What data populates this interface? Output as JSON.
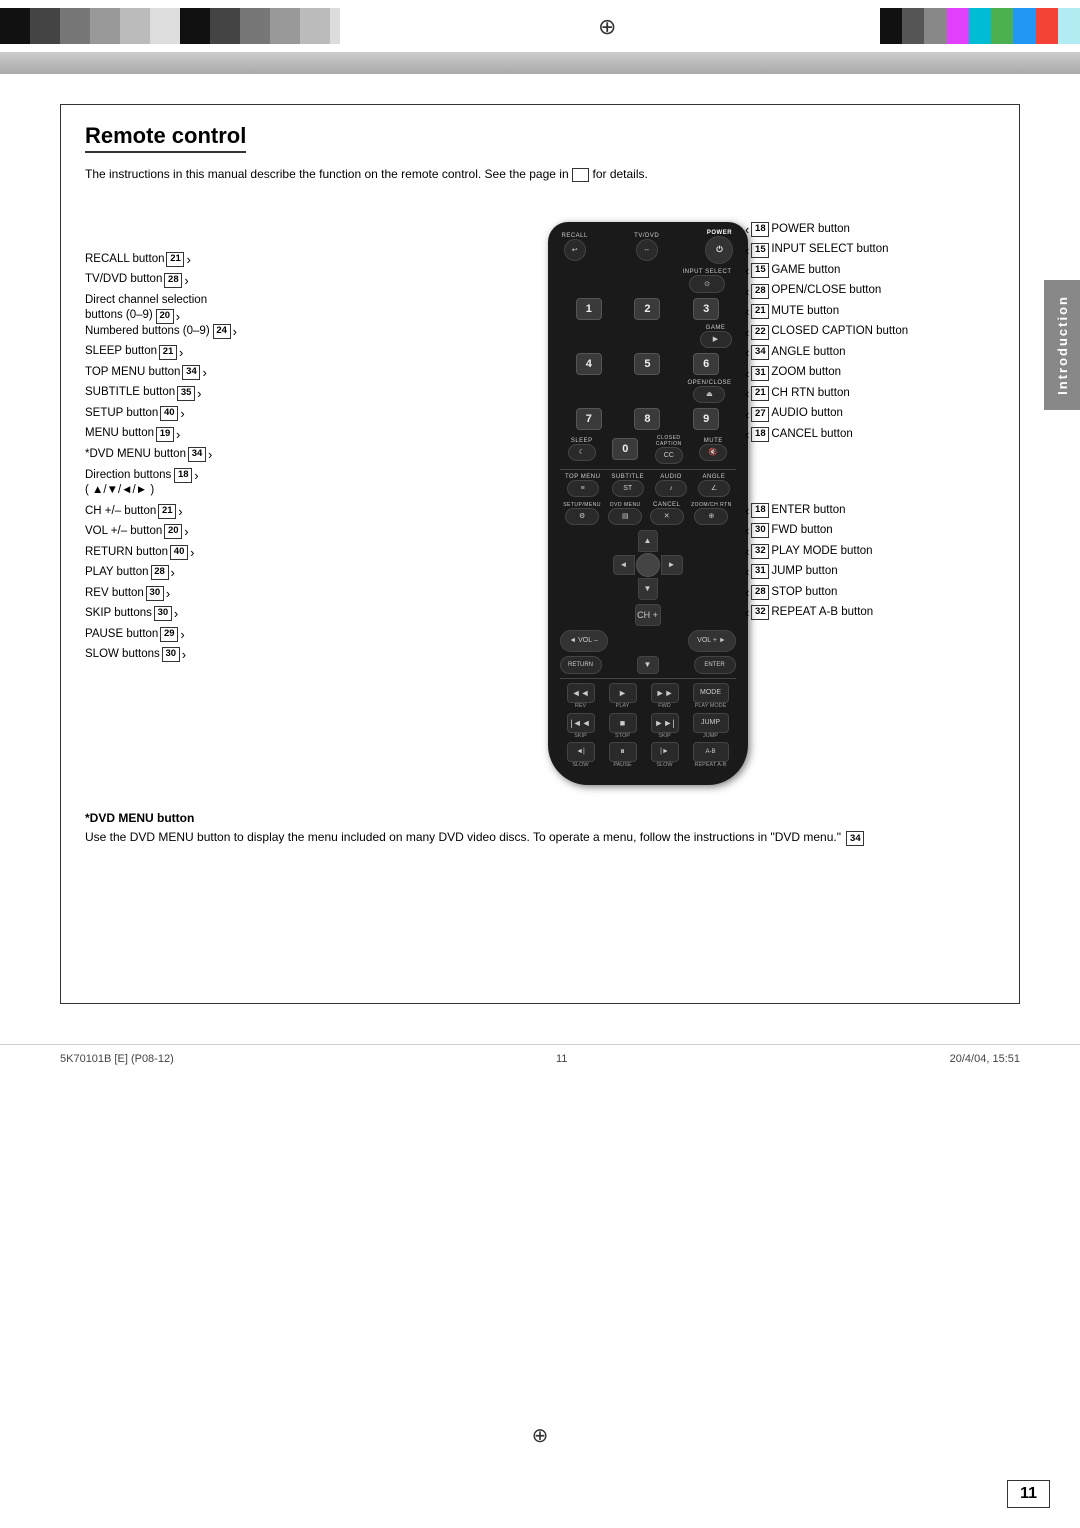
{
  "header": {
    "title": "Remote control",
    "intro": "The instructions in this manual describe the function on the remote control. See the page in",
    "intro_suffix": "for details."
  },
  "sidebar_label": "Introduction",
  "left_labels": [
    {
      "text": "RECALL button",
      "badge": "21",
      "arrow": "right"
    },
    {
      "text": "TV/DVD button",
      "badge": "28",
      "arrow": "right"
    },
    {
      "text": "Direct channel selection",
      "badge": "",
      "arrow": ""
    },
    {
      "text": "buttons (0–9)",
      "badge": "20",
      "arrow": "right"
    },
    {
      "text": "Numbered buttons (0–9)",
      "badge": "24",
      "arrow": "right"
    },
    {
      "text": "SLEEP button",
      "badge": "21",
      "arrow": "right"
    },
    {
      "text": "TOP MENU button",
      "badge": "34",
      "arrow": "right"
    },
    {
      "text": "SUBTITLE button",
      "badge": "35",
      "arrow": "right"
    },
    {
      "text": "SETUP button",
      "badge": "40",
      "arrow": "right"
    },
    {
      "text": "MENU button",
      "badge": "19",
      "arrow": "right"
    },
    {
      "text": "*DVD MENU button",
      "badge": "34",
      "arrow": "right"
    },
    {
      "text": "Direction buttons",
      "badge": "18",
      "arrow": "right"
    },
    {
      "text": "( ▲/▼/◄/► )",
      "badge": "",
      "arrow": ""
    },
    {
      "text": "CH +/– button",
      "badge": "21",
      "arrow": "right"
    },
    {
      "text": "VOL +/– button",
      "badge": "20",
      "arrow": "right"
    },
    {
      "text": "RETURN button",
      "badge": "40",
      "arrow": "right"
    },
    {
      "text": "PLAY button",
      "badge": "28",
      "arrow": "right"
    },
    {
      "text": "REV button",
      "badge": "30",
      "arrow": "right"
    },
    {
      "text": "SKIP buttons",
      "badge": "30",
      "arrow": "right"
    },
    {
      "text": "PAUSE button",
      "badge": "29",
      "arrow": "right"
    },
    {
      "text": "SLOW buttons",
      "badge": "30",
      "arrow": "right"
    }
  ],
  "right_labels": [
    {
      "text": "POWER button",
      "badge": "18",
      "arrow": "left"
    },
    {
      "text": "INPUT SELECT button",
      "badge": "15",
      "arrow": "left"
    },
    {
      "text": "GAME button",
      "badge": "15",
      "arrow": "left"
    },
    {
      "text": "OPEN/CLOSE button",
      "badge": "28",
      "arrow": "left"
    },
    {
      "text": "MUTE button",
      "badge": "21",
      "arrow": "left"
    },
    {
      "text": "CLOSED CAPTION button",
      "badge": "22",
      "arrow": "left"
    },
    {
      "text": "ANGLE button",
      "badge": "34",
      "arrow": "left"
    },
    {
      "text": "ZOOM button",
      "badge": "31",
      "arrow": "left"
    },
    {
      "text": "CH RTN button",
      "badge": "21",
      "arrow": "left"
    },
    {
      "text": "AUDIO button",
      "badge": "27",
      "arrow": "left"
    },
    {
      "text": "CANCEL button",
      "badge": "18",
      "arrow": "left"
    },
    {
      "text": "ENTER button",
      "badge": "18",
      "arrow": "left"
    },
    {
      "text": "FWD button",
      "badge": "30",
      "arrow": "left"
    },
    {
      "text": "PLAY MODE button",
      "badge": "32",
      "arrow": "left"
    },
    {
      "text": "JUMP button",
      "badge": "31",
      "arrow": "left"
    },
    {
      "text": "STOP button",
      "badge": "28",
      "arrow": "left"
    },
    {
      "text": "REPEAT A-B button",
      "badge": "32",
      "arrow": "left"
    }
  ],
  "dvd_note": {
    "title": "*DVD MENU button",
    "body": "Use the DVD MENU button to display the menu included on many DVD video discs. To operate a menu, follow the instructions in \"DVD menu.\"",
    "badge": "34"
  },
  "footer": {
    "left": "5K70101B [E] (P08-12)",
    "center": "11",
    "right": "20/4/04, 15:51"
  },
  "page_number": "11",
  "colors": {
    "black": "#111111",
    "magenta": "#e040fb",
    "cyan": "#00bcd4",
    "yellow": "#ffeb3b",
    "green": "#4caf50",
    "blue": "#2196f3",
    "red": "#f44336",
    "lightcyan": "#b2ebf2",
    "gray": "#888888"
  }
}
